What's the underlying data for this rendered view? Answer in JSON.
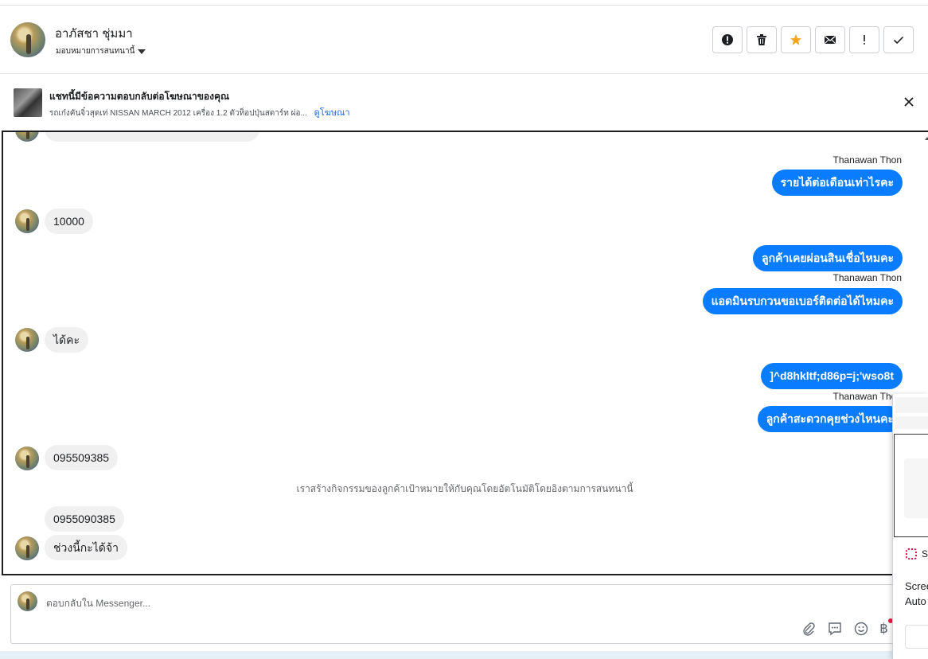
{
  "header": {
    "contact_name": "อาภัสชา ชุ่มมา",
    "assign_label": "มอบหมายการสนทนานี้",
    "actions": [
      "mark-spam",
      "delete",
      "star",
      "mark-unread",
      "flag",
      "mark-done"
    ]
  },
  "ad": {
    "title": "แชทนี้มีข้อความตอบกลับต่อโฆษณาของคุณ",
    "description": "รถเก๋งคันจิ๋วสุดเท่ NISSAN MARCH 2012 เครื่อง 1.2 ตัวท็อปปุ่นสตาร์ท ผ่อ...",
    "link": "ดูโฆษณา"
  },
  "messages": {
    "sender_1": "Thanawan Thon",
    "out_1": "รายได้ต่อเดือนเท่าไรคะ",
    "in_1": "10000",
    "out_2": "ลูกค้าเคยผ่อนสินเชื่อไหมคะ",
    "sender_2": "Thanawan Thon",
    "out_3": "แอดมินรบกวนขอเบอร์ติดต่อได้ไหมคะ",
    "in_2": "ได้คะ",
    "out_4": "]^d8hkltf;d86p=j;'wso8t",
    "sender_3": "Thanawan Thon",
    "out_5": "ลูกค้าสะดวกคุยช่วงไหนคะ",
    "in_3": "095509385",
    "system_note": "เราสร้างกิจกรรมของลูกค้าเป้าหมายให้กับคุณโดยอัตโนมัติโดยอิงตามการสนทนานี้",
    "in_4": "0955090385",
    "in_5": "ช่วงนี้กะได้จ้า"
  },
  "composer": {
    "placeholder": "ตอบกลับใน Messenger...",
    "currency_symbol": "฿"
  },
  "overlay": {
    "title_partial": "S",
    "line1": "Scree",
    "line2": "Auto"
  },
  "colors": {
    "outgoing_bubble": "#0a7cff",
    "incoming_bubble": "#f0f0f0",
    "link": "#216fdb",
    "star": "#f5a623"
  }
}
